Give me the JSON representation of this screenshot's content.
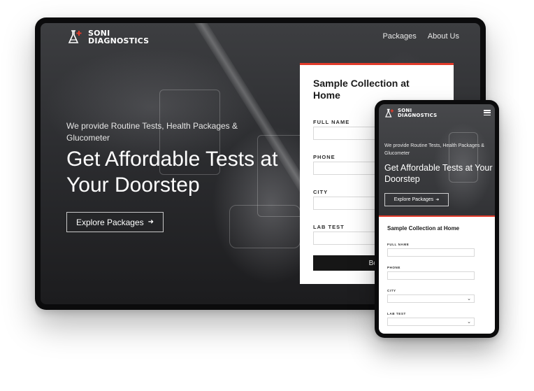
{
  "brand": {
    "name_line1": "SONI",
    "name_line2": "DIAGNOSTICS",
    "accent_color": "#e23b2a"
  },
  "nav": {
    "items": [
      "Packages",
      "About Us"
    ]
  },
  "hero": {
    "subtitle": "We provide Routine Tests, Health Packages & Glucometer",
    "title": "Get Affordable Tests at Your Doorstep",
    "cta_label": "Explore Packages",
    "cta_icon": "arrow-right-icon"
  },
  "desktop_form": {
    "title": "Sample Collection at Home",
    "fields": [
      {
        "label": "FULL NAME",
        "value": ""
      },
      {
        "label": "PHONE",
        "value": ""
      },
      {
        "label": "CITY",
        "value": ""
      },
      {
        "label": "LAB TEST",
        "value": ""
      }
    ],
    "submit_label_visible": "Book"
  },
  "mobile_form": {
    "title": "Sample Collection at Home",
    "fields": [
      {
        "label": "FULL NAME",
        "type": "text"
      },
      {
        "label": "PHONE",
        "type": "text"
      },
      {
        "label": "CITY",
        "type": "select"
      },
      {
        "label": "LAB TEST",
        "type": "select"
      }
    ]
  },
  "icons": {
    "logo": "flask-plus-icon",
    "menu": "hamburger-menu-icon"
  }
}
